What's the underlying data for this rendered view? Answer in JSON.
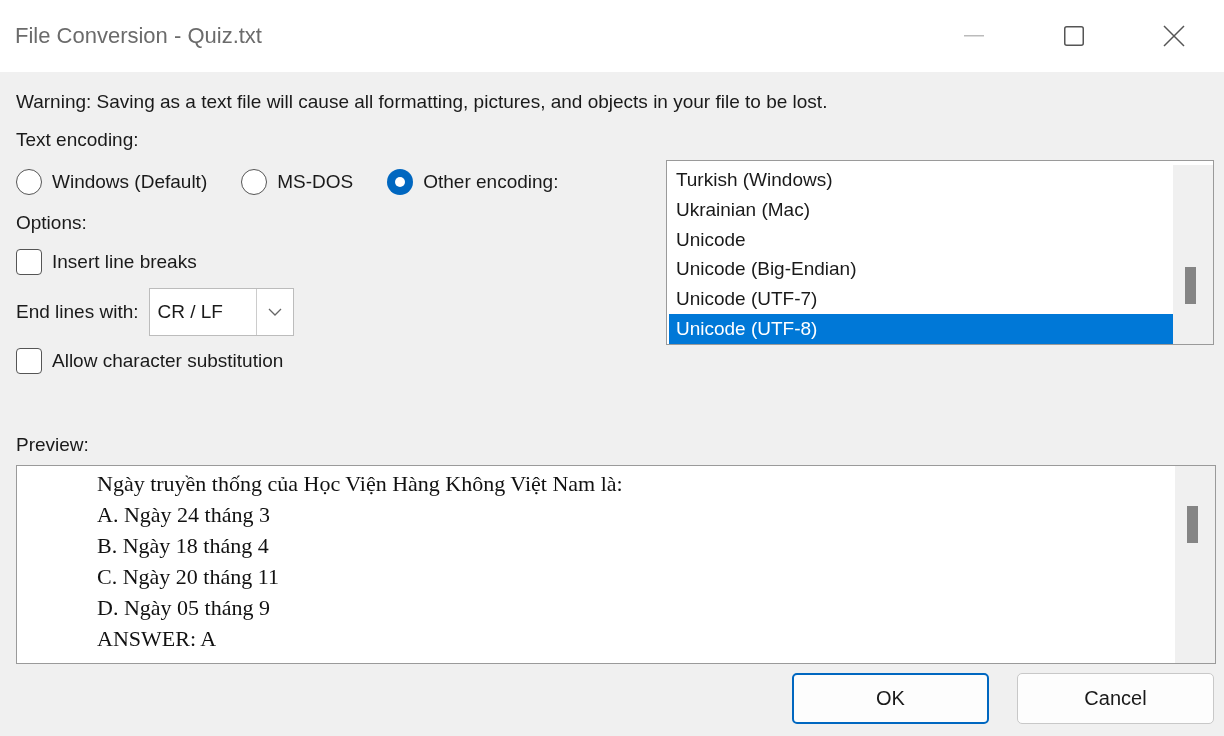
{
  "window": {
    "title": "File Conversion - Quiz.txt"
  },
  "warning": "Warning: Saving as a text file will cause all formatting, pictures, and objects in your file to be lost.",
  "text_encoding": {
    "label": "Text encoding:",
    "options": [
      {
        "label": "Windows (Default)",
        "selected": false
      },
      {
        "label": "MS-DOS",
        "selected": false
      },
      {
        "label": "Other encoding:",
        "selected": true
      }
    ]
  },
  "encoding_list": [
    {
      "label": "Turkish (Windows)",
      "selected": false
    },
    {
      "label": "Ukrainian (Mac)",
      "selected": false
    },
    {
      "label": "Unicode",
      "selected": false
    },
    {
      "label": "Unicode (Big-Endian)",
      "selected": false
    },
    {
      "label": "Unicode (UTF-7)",
      "selected": false
    },
    {
      "label": "Unicode (UTF-8)",
      "selected": true
    }
  ],
  "options": {
    "label": "Options:",
    "insert_line_breaks": {
      "label": "Insert line breaks",
      "checked": false
    },
    "end_lines": {
      "label": "End lines with:",
      "value": "CR / LF"
    },
    "allow_substitution": {
      "label": "Allow character substitution",
      "checked": false
    }
  },
  "preview": {
    "label": "Preview:",
    "lines": [
      "Ngày truyền thống của Học Viện Hàng Không Việt Nam là:",
      "A. Ngày 24 tháng 3",
      "B. Ngày 18 tháng 4",
      "C. Ngày 20 tháng 11",
      "D. Ngày 05 tháng 9",
      "ANSWER: A"
    ]
  },
  "buttons": [
    {
      "label": "OK",
      "kind": "default"
    },
    {
      "label": "Cancel",
      "kind": "normal"
    }
  ]
}
